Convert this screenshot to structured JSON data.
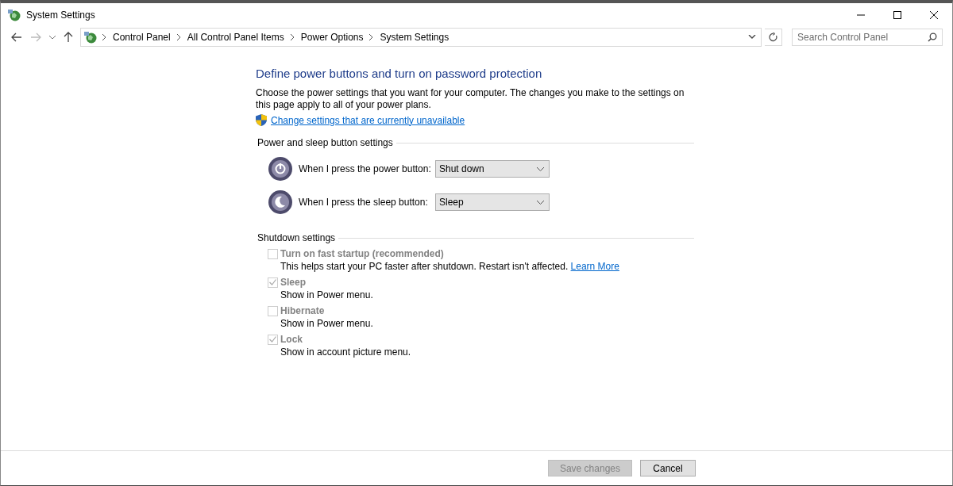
{
  "window": {
    "title": "System Settings"
  },
  "breadcrumb": [
    "Control Panel",
    "All Control Panel Items",
    "Power Options",
    "System Settings"
  ],
  "search": {
    "placeholder": "Search Control Panel"
  },
  "heading": "Define power buttons and turn on password protection",
  "intro": "Choose the power settings that you want for your computer. The changes you make to the settings on this page apply to all of your power plans.",
  "admin_link": "Change settings that are currently unavailable",
  "power_section": {
    "title": "Power and sleep button settings",
    "rows": [
      {
        "kind": "power",
        "label": "When I press the power button:",
        "value": "Shut down"
      },
      {
        "kind": "sleep",
        "label": "When I press the sleep button:",
        "value": "Sleep"
      }
    ]
  },
  "shutdown_section": {
    "title": "Shutdown settings",
    "options": [
      {
        "label": "Turn on fast startup (recommended)",
        "checked": false,
        "disabled": true,
        "description": "This helps start your PC faster after shutdown. Restart isn't affected.",
        "link": "Learn More"
      },
      {
        "label": "Sleep",
        "checked": true,
        "disabled": true,
        "description": "Show in Power menu."
      },
      {
        "label": "Hibernate",
        "checked": false,
        "disabled": true,
        "description": "Show in Power menu."
      },
      {
        "label": "Lock",
        "checked": true,
        "disabled": true,
        "description": "Show in account picture menu."
      }
    ]
  },
  "buttons": [
    {
      "label": "Save changes",
      "disabled": true
    },
    {
      "label": "Cancel",
      "disabled": false
    }
  ]
}
